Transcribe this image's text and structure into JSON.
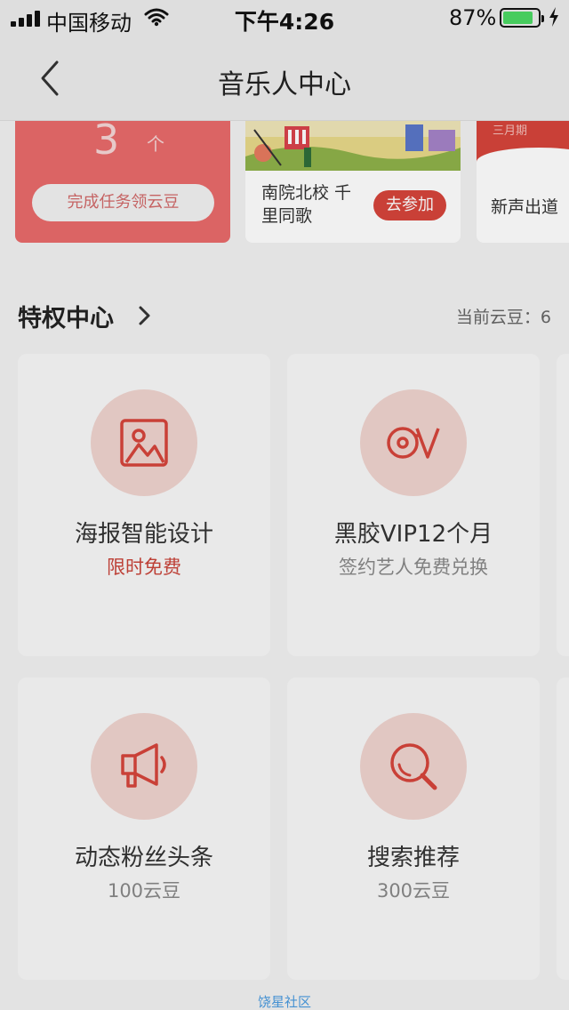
{
  "status_bar": {
    "carrier": "中国移动",
    "time": "下午4:26",
    "battery_pct": "87%",
    "battery_level": 0.87
  },
  "nav": {
    "title": "音乐人中心"
  },
  "task_card": {
    "count": "3",
    "unit": "个",
    "button": "完成任务领云豆"
  },
  "event_card": {
    "name": "南院北校 千里同歌",
    "join": "去参加"
  },
  "event_card2": {
    "tag": "三月期",
    "name": "新声出道"
  },
  "section": {
    "title": "特权中心",
    "beans": "当前云豆：6"
  },
  "privileges": [
    {
      "title": "海报智能设计",
      "subtitle": "限时免费",
      "icon": "image-icon"
    },
    {
      "title": "黑胶VIP12个月",
      "subtitle": "签约艺人免费兑换",
      "icon": "vinyl-vip-icon"
    },
    {
      "title": "动态粉丝头条",
      "subtitle": "100云豆",
      "icon": "megaphone-icon"
    },
    {
      "title": "搜索推荐",
      "subtitle": "300云豆",
      "icon": "search-icon"
    }
  ],
  "footer": {
    "link": "饶星社区"
  },
  "colors": {
    "accent": "#d6453b",
    "icon_circle": "#f0d4cf",
    "task_card": "#e96b6b"
  }
}
